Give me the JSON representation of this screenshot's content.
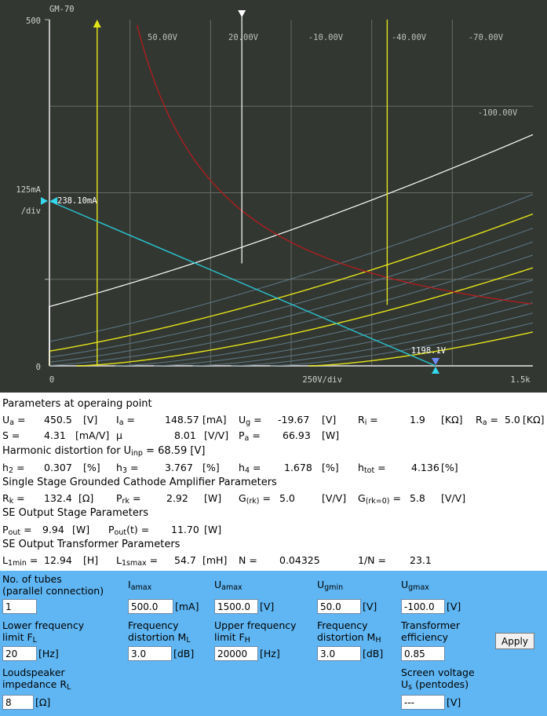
{
  "chart_data": {
    "type": "line",
    "title": "GM-70",
    "x_tick_labels": [
      "0",
      "250V/div",
      "1.5k"
    ],
    "y_tick_labels": [
      "0",
      "125mA",
      "/div",
      "500"
    ],
    "xlim": [
      0,
      1500
    ],
    "ylim": [
      0,
      500
    ],
    "grid": true,
    "curve_labels": [
      "50.00V",
      "20.00V",
      "-10.00V",
      "-40.00V",
      "-70.00V",
      "-100.00V"
    ],
    "grid_curve_voltages": [
      70,
      50,
      35,
      20,
      5,
      -10,
      -25,
      -40,
      -55,
      -70,
      -85,
      -100
    ],
    "highlight_curves_grid_voltage": [
      50,
      -10,
      -100
    ],
    "max_power_hyperbola_watts": 66.93,
    "load_line": {
      "x": [
        0,
        1198.1
      ],
      "y": [
        238.1,
        0
      ]
    },
    "operating_point": {
      "ua": 450.5,
      "ia": 148.57
    },
    "markers": {
      "ia_intercept": "238.10mA",
      "ua_intercept": "1198.1V",
      "ua_intercept_value": 1198.1,
      "ia_intercept_value": 238.1
    },
    "yellow_vertical_lines_x": [
      148,
      1048
    ],
    "white_vertical_line_x": 597,
    "colors": {
      "grid_curves": "#5d7988",
      "highlight": "#e3e318",
      "operating_curve": "#ffffff",
      "hyperbola": "#b41c1c",
      "load_line": "#27c4cf",
      "marker": "#35d8ec",
      "marker_down": "#6e8cff"
    }
  },
  "params": {
    "op_header": "Parameters at operaing point",
    "row1": {
      "ua_label": "U",
      "ua_sub": "a",
      "ua_value": "450.5",
      "ua_unit": "[V]",
      "ia_label": "I",
      "ia_sub": "a",
      "ia_value": "148.57",
      "ia_unit": "[mA]",
      "ug_label": "U",
      "ug_sub": "g",
      "ug_value": "-19.67",
      "ug_unit": "[V]",
      "ri_label": "R",
      "ri_sub": "i",
      "ri_value": "1.9",
      "ri_unit": "[KΩ]",
      "ra_label": "R",
      "ra_sub": "a",
      "ra_value": "5.0",
      "ra_unit": "[KΩ]"
    },
    "row2": {
      "s_label": "S =",
      "s_value": "4.31",
      "s_unit": "[mA/V]",
      "mu_label": "μ",
      "mu_value": "8.01",
      "mu_unit": "[V/V]",
      "pa_label": "P",
      "pa_sub": "a",
      "pa_value": "66.93",
      "pa_unit": "[W]"
    },
    "harm_header": "Harmonic distortion for U",
    "harm_header_sub": "inp",
    "harm_header_value": "= 68.59 [V]",
    "row3": {
      "h2_label": "h",
      "h2_sub": "2",
      "h2_value": "0.307",
      "h2_unit": "[%]",
      "h3_label": "h",
      "h3_sub": "3",
      "h3_value": "3.767",
      "h3_unit": "[%]",
      "h4_label": "h",
      "h4_sub": "4",
      "h4_value": "1.678",
      "h4_unit": "[%]",
      "htot_label": "h",
      "htot_sub": "tot",
      "htot_value": "4.136",
      "htot_unit": "[%]"
    },
    "ss_header": "Single Stage Grounded Cathode Amplifier Parameters",
    "row4": {
      "rk_label": "R",
      "rk_sub": "k",
      "rk_value": "132.4",
      "rk_unit": "[Ω]",
      "prk_label": "P",
      "prk_sub": "rk",
      "prk_value": "2.92",
      "prk_unit": "[W]",
      "g_label": "G",
      "g_sub": "(rk)",
      "g_value": "5.0",
      "g_unit": "[V/V]",
      "g0_label": "G",
      "g0_sub": "(rk=0)",
      "g0_value": "5.8",
      "g0_unit": "[V/V]"
    },
    "se_header": "SE Output Stage Parameters",
    "row5": {
      "pout_label": "P",
      "pout_sub": "out",
      "pout_value": "9.94",
      "pout_unit": "[W]",
      "poutt_label": "P",
      "poutt_sub": "out",
      "poutt_suffix": "(t)",
      "poutt_value": "11.70",
      "poutt_unit": "[W]"
    },
    "tr_header": "SE Output Transformer Parameters",
    "row6": {
      "l1min_label": "L",
      "l1min_sub": "1min",
      "l1min_value": "12.94",
      "l1min_unit": "[H]",
      "l1smax_label": "L",
      "l1smax_sub": "1smax",
      "l1smax_value": "54.7",
      "l1smax_unit": "[mH]",
      "n_label": "N =",
      "n_value": "0.04325",
      "inv_label": "1/N =",
      "inv_value": "23.1"
    }
  },
  "form": {
    "tubes_label1": "No. of tubes",
    "tubes_label2": "(parallel connection)",
    "tubes_value": "1",
    "iamax_label": "I",
    "iamax_sub": "amax",
    "iamax_value": "500.0",
    "iamax_unit": "[mA]",
    "uamax_label": "U",
    "uamax_sub": "amax",
    "uamax_value": "1500.0",
    "uamax_unit": "[V]",
    "ugmin_label": "U",
    "ugmin_sub": "gmin",
    "ugmin_value": "50.0",
    "ugmin_unit": "[V]",
    "ugmax_label": "U",
    "ugmax_sub": "gmax",
    "ugmax_value": "-100.0",
    "ugmax_unit": "[V]",
    "fl_label1": "Lower frequency",
    "fl_label2": "limit F",
    "fl_sub": "L",
    "fl_value": "20",
    "fl_unit": "[Hz]",
    "ml_label1": "Frequency",
    "ml_label2": "distortion M",
    "ml_sub": "L",
    "ml_value": "3.0",
    "ml_unit": "[dB]",
    "fh_label1": "Upper frequency",
    "fh_label2": "limit F",
    "fh_sub": "H",
    "fh_value": "20000",
    "fh_unit": "[Hz]",
    "mh_label1": "Frequency",
    "mh_label2": "distortion M",
    "mh_sub": "H",
    "mh_value": "3.0",
    "mh_unit": "[dB]",
    "eff_label1": "Transformer",
    "eff_label2": "efficiency",
    "eff_value": "0.85",
    "apply_label": "Apply",
    "rl_label1": "Loudspeaker",
    "rl_label2": "impedance R",
    "rl_sub": "L",
    "rl_value": "8",
    "rl_unit": "[Ω]",
    "us_label1": "Screen voltage",
    "us_label2": "U",
    "us_sub": "s",
    "us_label2_suffix": " (pentodes)",
    "us_value": "---",
    "us_unit": "[V]"
  }
}
